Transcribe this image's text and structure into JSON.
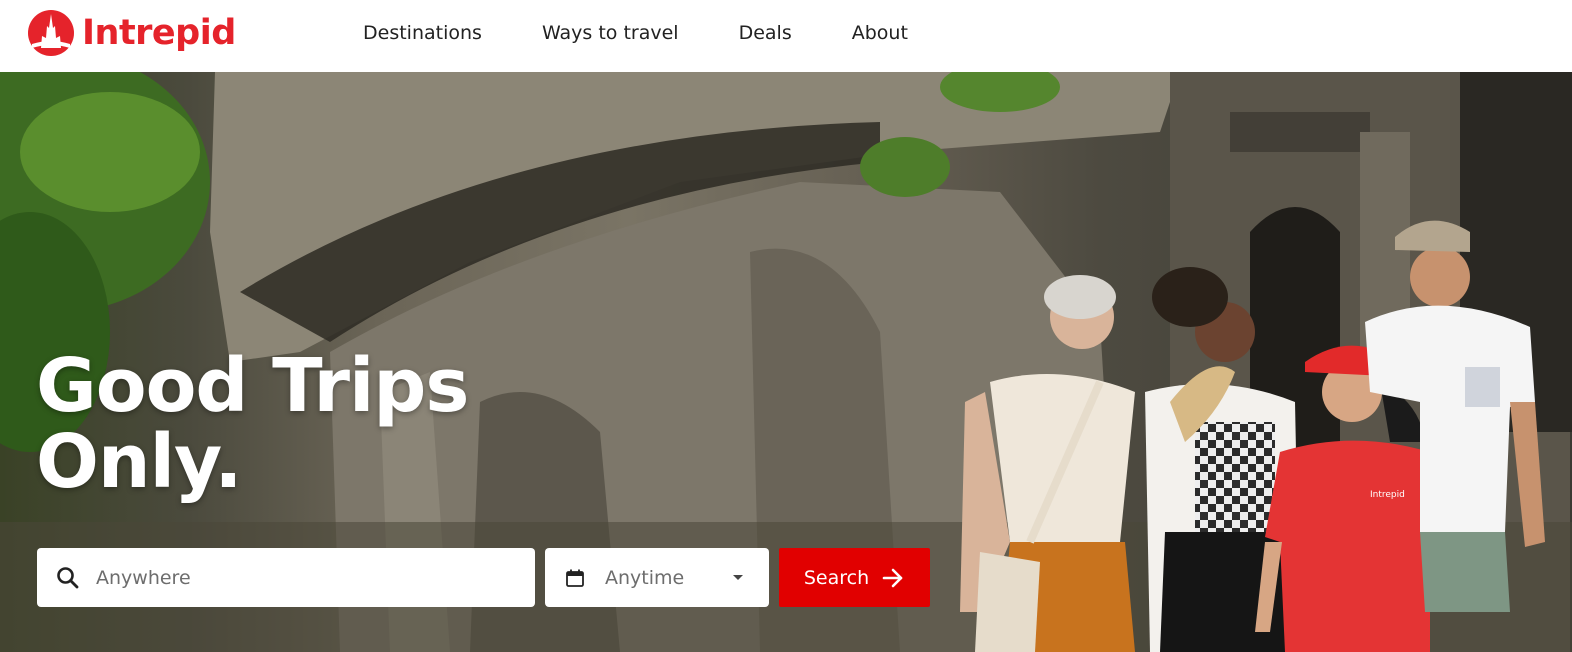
{
  "brand": {
    "name": "Intrepid",
    "color": "#e5232b"
  },
  "nav": {
    "items": [
      {
        "label": "Destinations"
      },
      {
        "label": "Ways to travel"
      },
      {
        "label": "Deals"
      },
      {
        "label": "About"
      }
    ]
  },
  "hero": {
    "headline_line1": "Good Trips",
    "headline_line2": "Only.",
    "image_alt_icon": "photo-travellers-rock-wall",
    "shirt_logo_text": "Intrepid"
  },
  "search": {
    "destination_placeholder": "Anywhere",
    "date_placeholder": "Anytime",
    "button_label": "Search",
    "button_color": "#e10000"
  }
}
